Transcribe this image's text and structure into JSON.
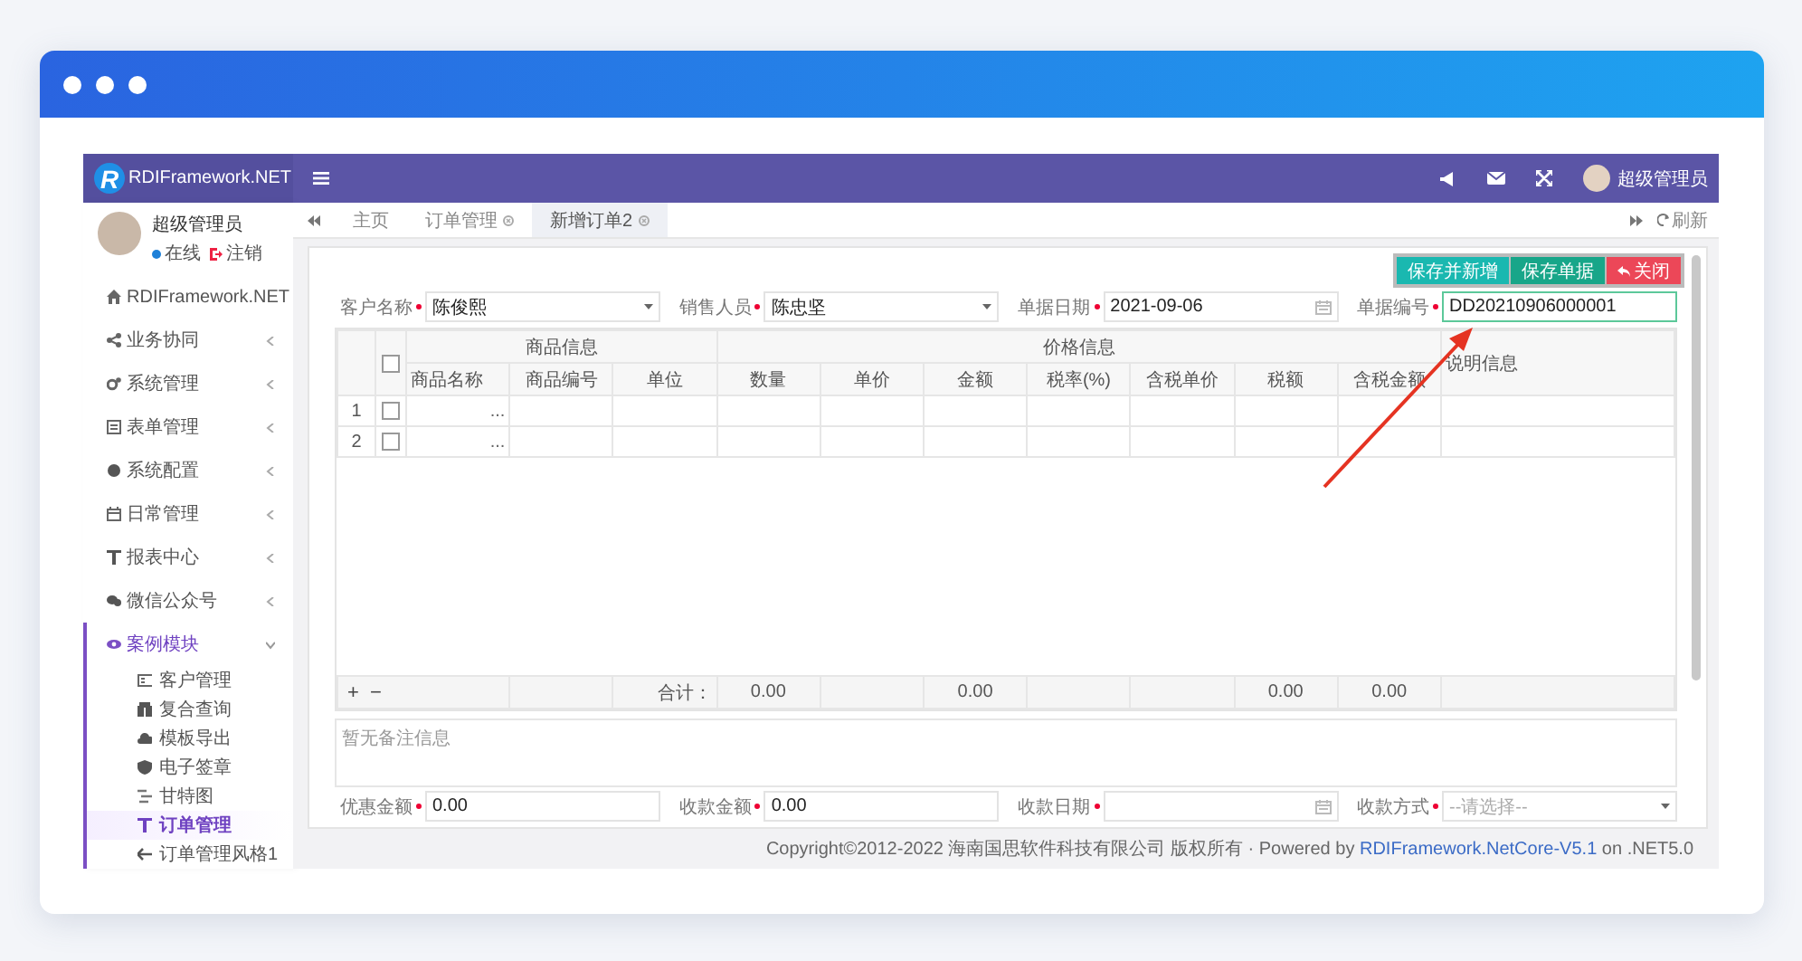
{
  "app": {
    "logo_mark": "R",
    "logo_text": "RDIFramework.NET"
  },
  "header": {
    "user_name": "超级管理员"
  },
  "sidebar": {
    "user": {
      "name": "超级管理员",
      "status": "在线",
      "logout": "注销"
    },
    "items": [
      {
        "label": "RDIFramework.NET",
        "expanded": false
      },
      {
        "label": "业务协同",
        "expanded": false
      },
      {
        "label": "系统管理",
        "expanded": false
      },
      {
        "label": "表单管理",
        "expanded": false
      },
      {
        "label": "系统配置",
        "expanded": false
      },
      {
        "label": "日常管理",
        "expanded": false
      },
      {
        "label": "报表中心",
        "expanded": false
      },
      {
        "label": "微信公众号",
        "expanded": false
      },
      {
        "label": "案例模块",
        "expanded": true,
        "children": [
          {
            "label": "客户管理",
            "selected": false
          },
          {
            "label": "复合查询",
            "selected": false
          },
          {
            "label": "模板导出",
            "selected": false
          },
          {
            "label": "电子签章",
            "selected": false
          },
          {
            "label": "甘特图",
            "selected": false
          },
          {
            "label": "订单管理",
            "selected": true
          },
          {
            "label": "订单管理风格1",
            "selected": false
          }
        ]
      }
    ]
  },
  "tabs": [
    {
      "label": "主页",
      "closable": false,
      "selected": false
    },
    {
      "label": "订单管理",
      "closable": true,
      "selected": false
    },
    {
      "label": "新增订单2",
      "closable": true,
      "selected": true
    }
  ],
  "refresh": "刷新",
  "buttons": [
    {
      "label": "保存并新增",
      "kind": "primary"
    },
    {
      "label": "保存单据",
      "kind": "success"
    },
    {
      "label": "关闭",
      "kind": "danger"
    }
  ],
  "top_fields": [
    {
      "label": "客户名称",
      "required": true,
      "kind": "select",
      "value": "陈俊熙",
      "focused": false
    },
    {
      "label": "销售人员",
      "required": true,
      "kind": "select",
      "value": "陈忠坚",
      "focused": false
    },
    {
      "label": "单据日期",
      "required": true,
      "kind": "date",
      "value": "2021-09-06",
      "focused": false
    },
    {
      "label": "单据编号",
      "required": true,
      "kind": "text",
      "value": "DD20210906000001",
      "focused": true
    }
  ],
  "table": {
    "all_checked": false,
    "groups": [
      {
        "label": "商品信息",
        "columns": [
          {
            "label": "商品名称"
          },
          {
            "label": "商品编号"
          },
          {
            "label": "单位"
          }
        ]
      },
      {
        "label": "价格信息",
        "columns": [
          {
            "label": "数量",
            "total": "0.00"
          },
          {
            "label": "单价"
          },
          {
            "label": "金额",
            "total": "0.00"
          },
          {
            "label": "税率(%)"
          },
          {
            "label": "含税单价"
          },
          {
            "label": "税额",
            "total": "0.00"
          },
          {
            "label": "含税金额",
            "total": "0.00"
          }
        ]
      },
      {
        "label": "说明信息"
      }
    ],
    "rows": [
      {
        "index": "1",
        "checked": false,
        "picker": "..."
      },
      {
        "index": "2",
        "checked": false,
        "picker": "..."
      }
    ],
    "add": "+",
    "remove": "−",
    "total_label": "合计："
  },
  "remarks": {
    "placeholder": "暂无备注信息"
  },
  "bottom_fields": [
    {
      "label": "优惠金额",
      "required": true,
      "kind": "text",
      "value": "0.00",
      "focused": false
    },
    {
      "label": "收款金额",
      "required": true,
      "kind": "text",
      "value": "0.00",
      "focused": false
    },
    {
      "label": "收款日期",
      "required": true,
      "kind": "date",
      "focused": false
    },
    {
      "label": "收款方式",
      "required": true,
      "kind": "select",
      "placeholder": "--请选择--",
      "focused": false
    }
  ],
  "footer": {
    "text": "Copyright©2012-2022 海南国思软件科技有限公司 版权所有 · Powered by",
    "link": "RDIFramework.NetCore-V5.1",
    "suffix": "on .NET5.0"
  }
}
